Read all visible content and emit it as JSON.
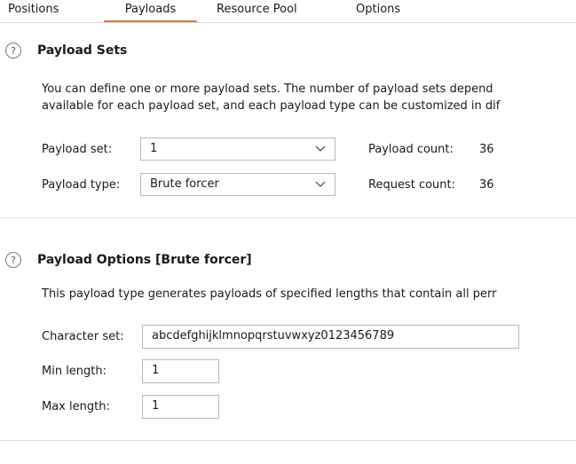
{
  "tabs": [
    {
      "label": "Positions"
    },
    {
      "label": "Payloads",
      "active": true
    },
    {
      "label": "Resource Pool"
    },
    {
      "label": "Options"
    }
  ],
  "accent_color": "#e8713a",
  "payload_sets": {
    "help_icon": "question-circle-icon",
    "title": "Payload Sets",
    "description_line1": "You can define one or more payload sets. The number of payload sets depend",
    "description_line2": "available for each payload set, and each payload type can be customized in dif",
    "payload_set_label": "Payload set:",
    "payload_set_value": "1",
    "payload_type_label": "Payload type:",
    "payload_type_value": "Brute forcer",
    "payload_count_label": "Payload count:",
    "payload_count_value": "36",
    "request_count_label": "Request count:",
    "request_count_value": "36"
  },
  "payload_options": {
    "help_icon": "question-circle-icon",
    "title": "Payload Options [Brute forcer]",
    "description": "This payload type generates payloads of specified lengths that contain all perr",
    "character_set_label": "Character set:",
    "character_set_value": "abcdefghijklmnopqrstuvwxyz0123456789",
    "min_length_label": "Min length:",
    "min_length_value": "1",
    "max_length_label": "Max length:",
    "max_length_value": "1"
  }
}
